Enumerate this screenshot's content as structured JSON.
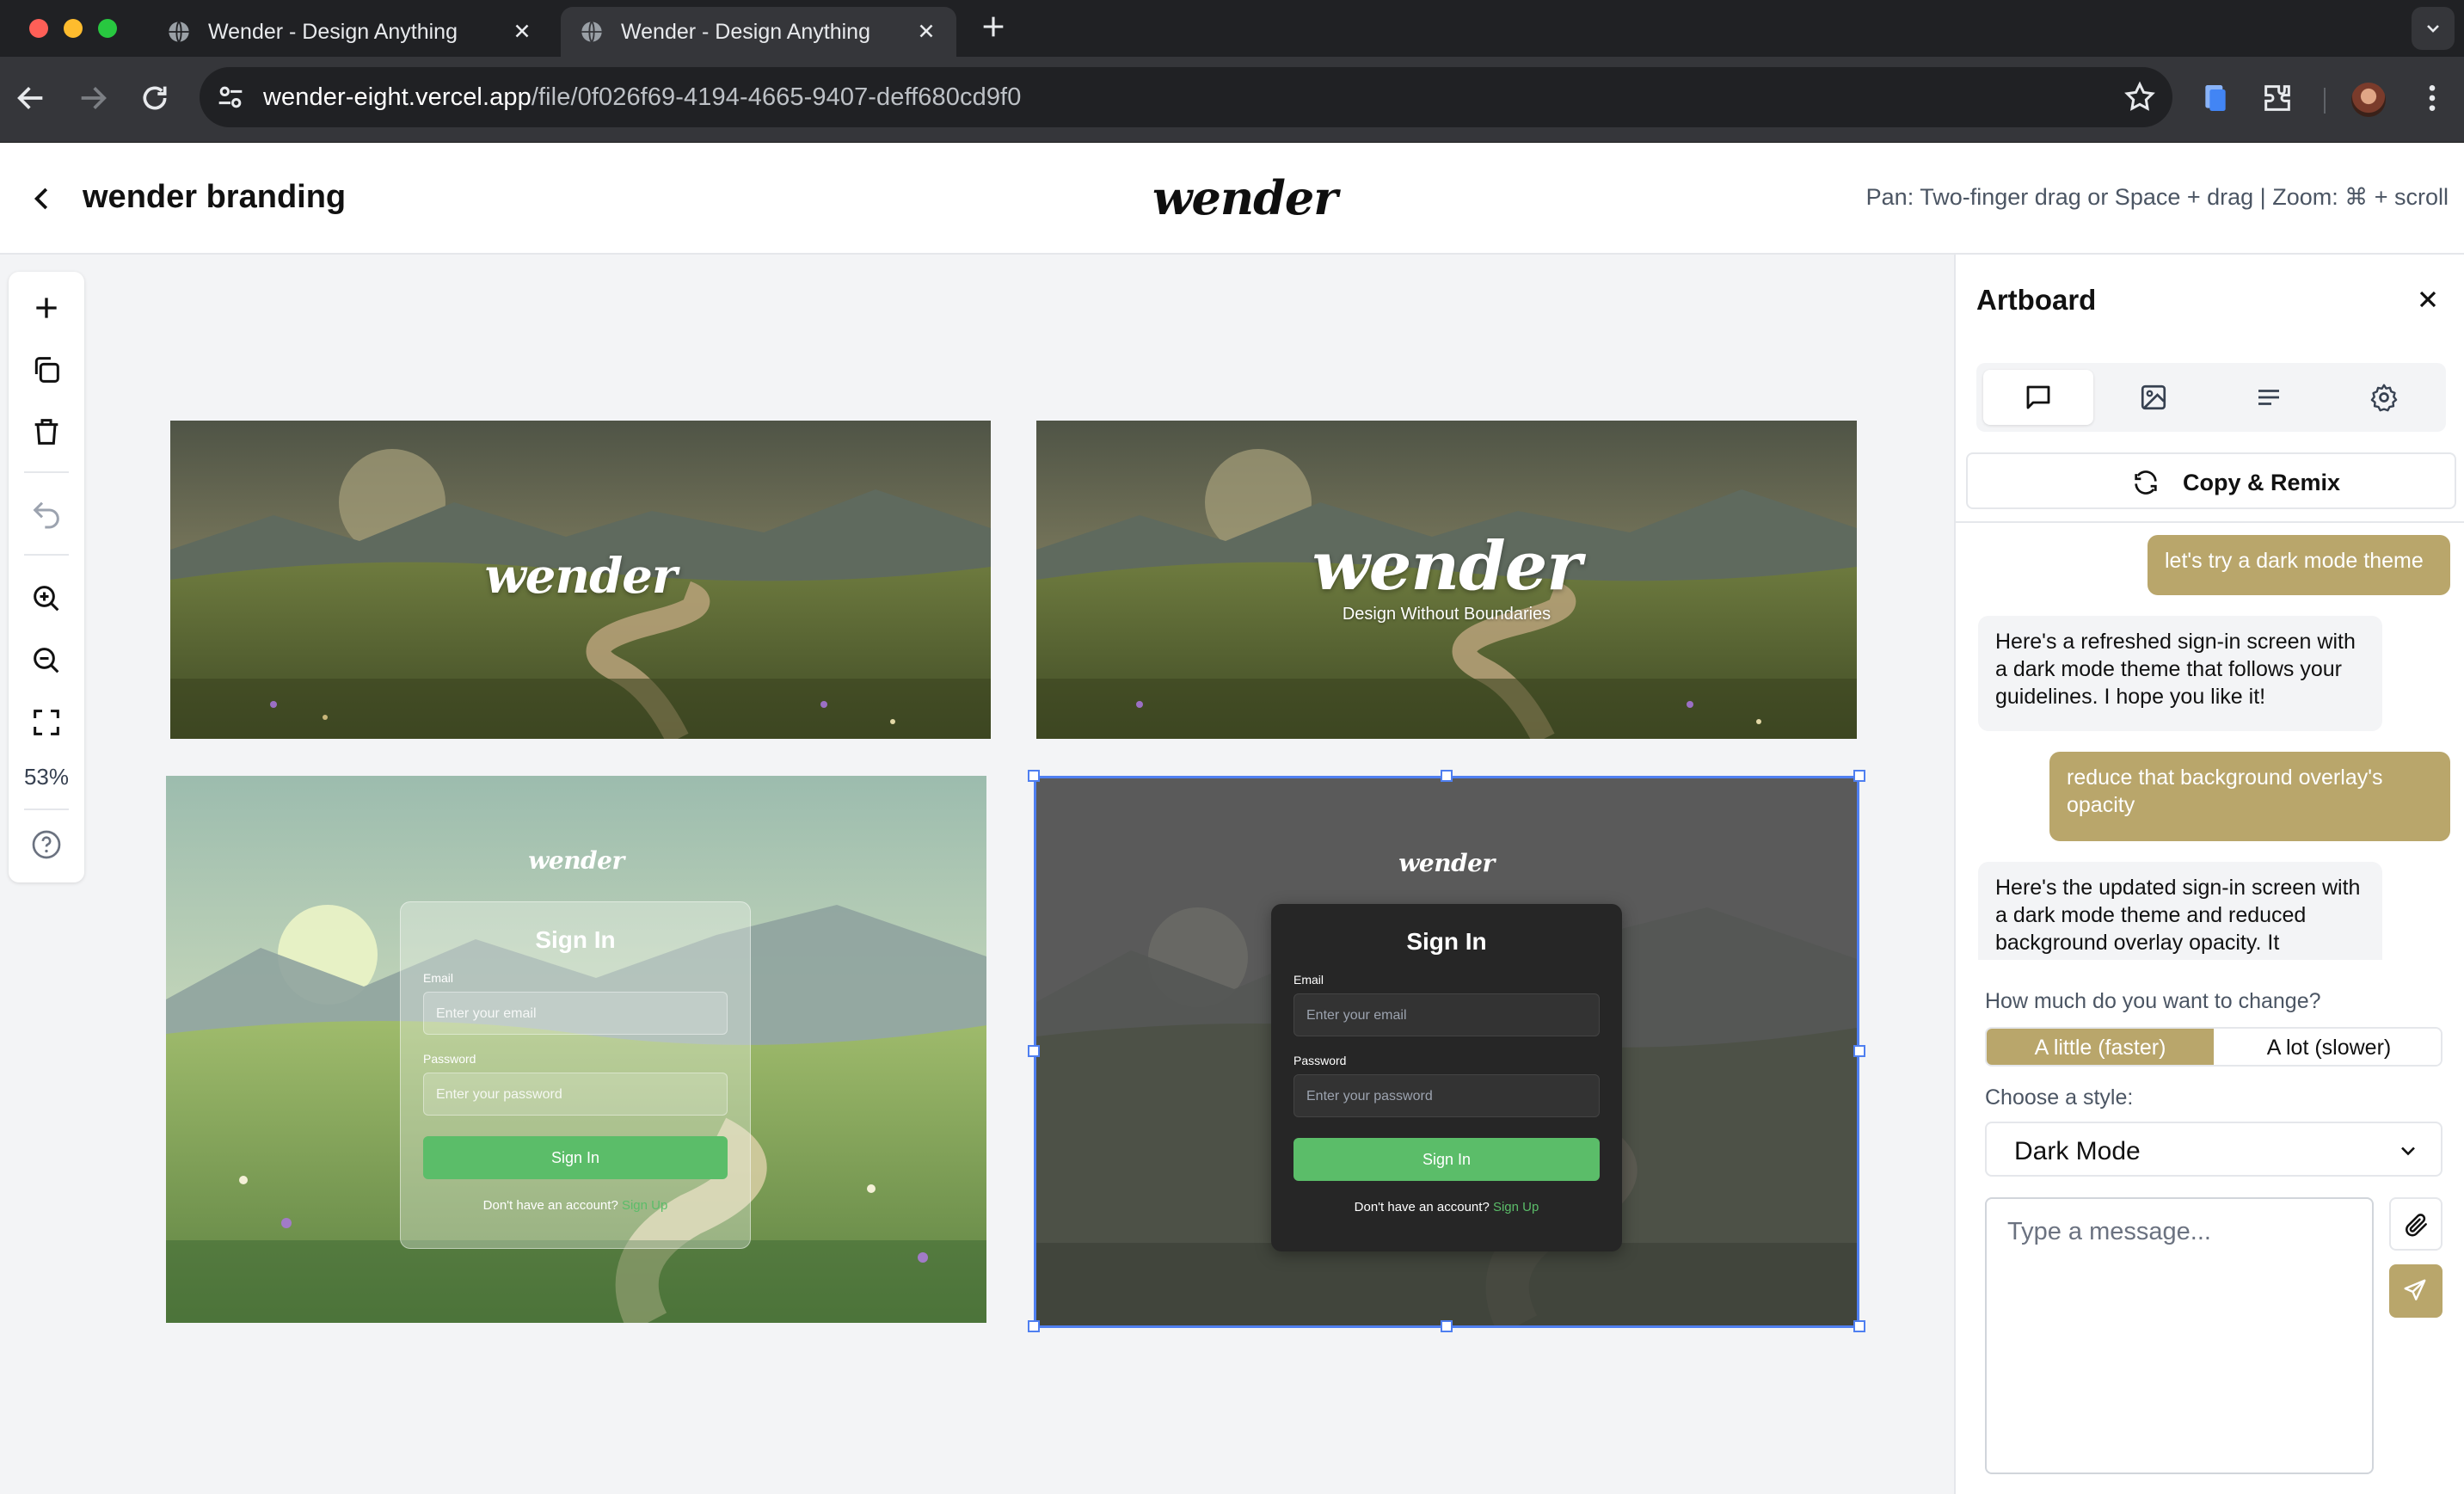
{
  "browser": {
    "tabs": [
      {
        "title": "Wender - Design Anything",
        "active": false
      },
      {
        "title": "Wender - Design Anything",
        "active": true
      }
    ],
    "url_host": "wender-eight.vercel.app",
    "url_path": "/file/0f026f69-4194-4665-9407-deff680cd9f0"
  },
  "header": {
    "file_title": "wender branding",
    "logo": "wender",
    "hint": "Pan: Two-finger drag or Space + drag | Zoom: ⌘ + scroll"
  },
  "toolbar": {
    "zoom_level": "53%"
  },
  "canvas": {
    "banner1": {
      "logo": "wender"
    },
    "banner2": {
      "logo": "wender",
      "tagline": "Design Without Boundaries"
    },
    "signin_light": {
      "logo": "wender",
      "title": "Sign In",
      "email_label": "Email",
      "email_placeholder": "Enter your email",
      "password_label": "Password",
      "password_placeholder": "Enter your password",
      "button": "Sign In",
      "footer_text": "Don't have an account?",
      "footer_link": "Sign Up"
    },
    "signin_dark": {
      "logo": "wender",
      "title": "Sign In",
      "email_label": "Email",
      "email_placeholder": "Enter your email",
      "password_label": "Password",
      "password_placeholder": "Enter your password",
      "button": "Sign In",
      "footer_text": "Don't have an account?",
      "footer_link": "Sign Up"
    }
  },
  "panel": {
    "title": "Artboard",
    "tabs": [
      "chat-icon",
      "image-icon",
      "text-align-icon",
      "gear-icon"
    ],
    "remix_label": "Copy & Remix",
    "messages": [
      {
        "role": "user",
        "text": "let's try a dark mode theme"
      },
      {
        "role": "assistant",
        "text": "Here's a refreshed sign-in screen with a dark mode theme that follows your guidelines. I hope you like it!"
      },
      {
        "role": "user",
        "text": "reduce that background overlay's opacity"
      },
      {
        "role": "assistant",
        "text": "Here's the updated sign-in screen with a dark mode theme and reduced background overlay opacity. It"
      }
    ],
    "change_label": "How much do you want to change?",
    "change_options": [
      "A little (faster)",
      "A lot (slower)"
    ],
    "style_label": "Choose a style:",
    "style_value": "Dark Mode",
    "message_placeholder": "Type a message..."
  },
  "colors": {
    "accent": "#b9a66b",
    "selection": "#4f7ff0",
    "signin_green": "#5bbd69"
  }
}
